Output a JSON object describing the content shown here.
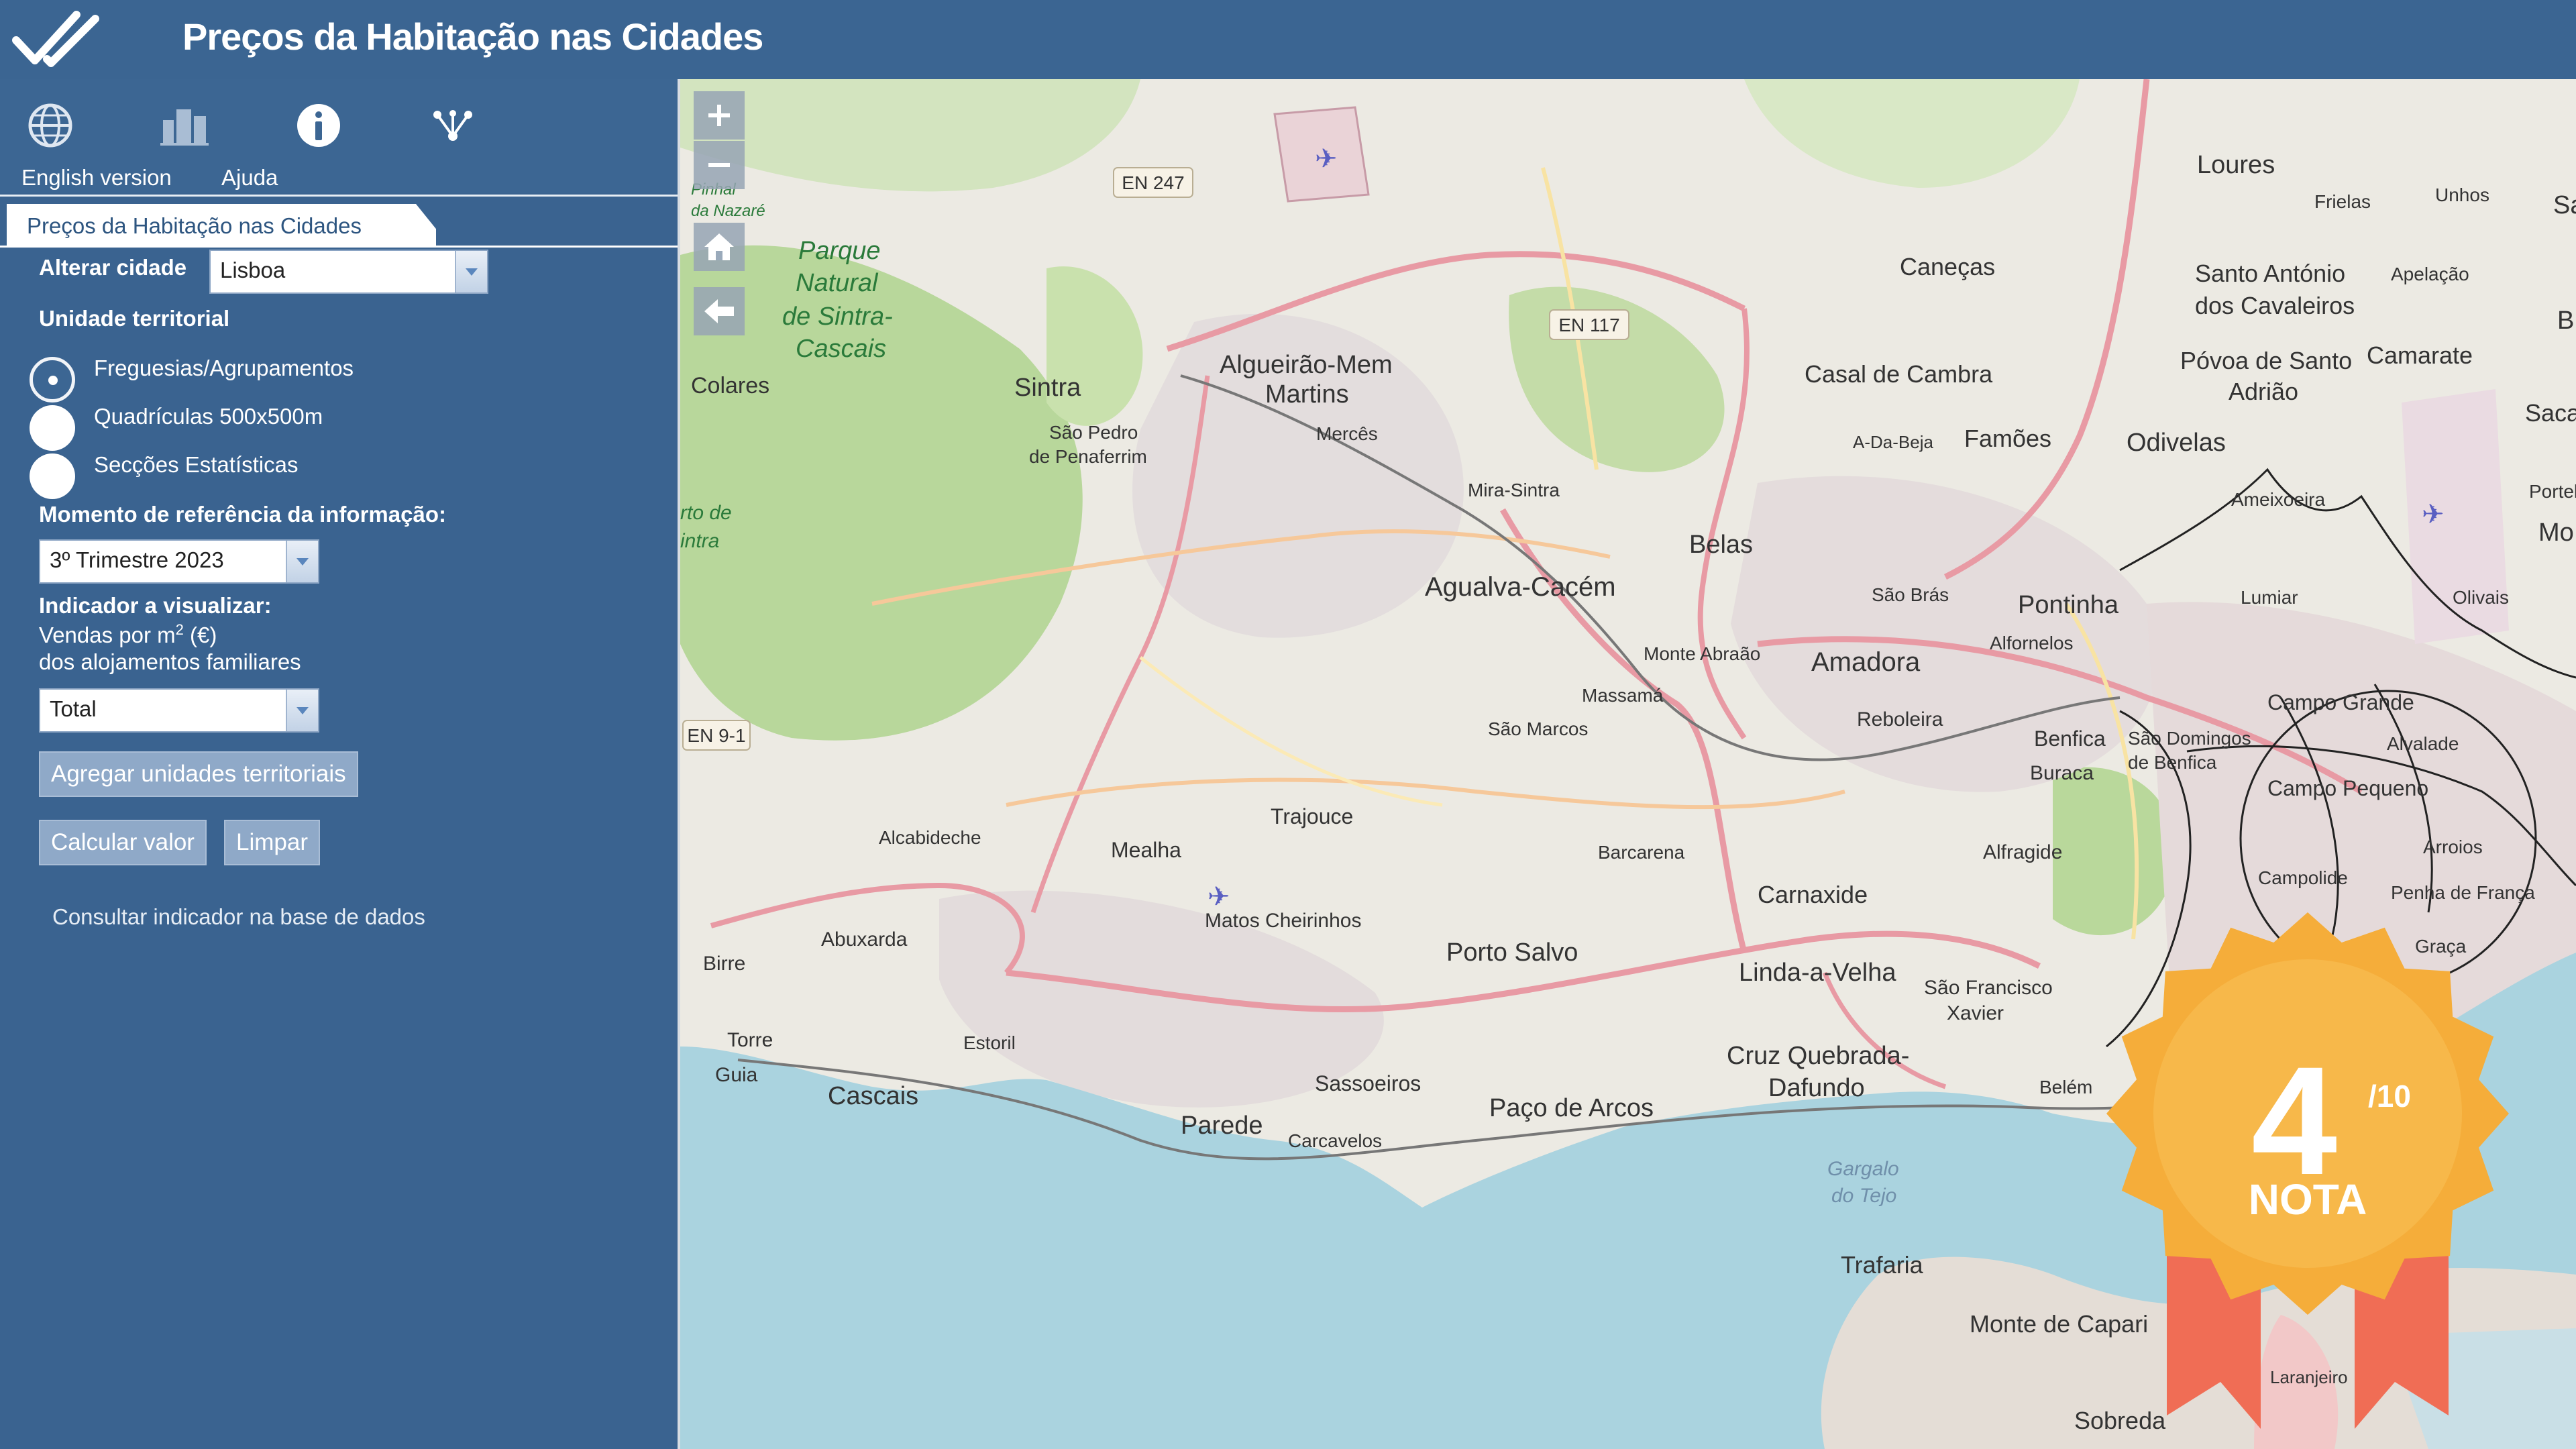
{
  "header": {
    "title": "Preços da Habitação nas Cidades"
  },
  "toolbar": {
    "tools": [
      {
        "icon": "globe-icon",
        "label": "English version"
      },
      {
        "icon": "buildings-icon",
        "label": "Ajuda"
      },
      {
        "icon": "info-icon"
      },
      {
        "icon": "share-network-icon"
      }
    ]
  },
  "panel": {
    "tab_title": "Preços da Habitação nas Cidades",
    "city_label": "Alterar cidade",
    "city_value": "Lisboa",
    "territorial_label": "Unidade territorial",
    "territorial_options": [
      "Freguesias/Agrupamentos",
      "Quadrículas 500x500m",
      "Secções Estatísticas"
    ],
    "territorial_selected": 0,
    "reference_label": "Momento de referência da informação:",
    "reference_value": "3º Trimestre 2023",
    "indicator_label": "Indicador a visualizar:",
    "indicator_line1": "Vendas por m",
    "indicator_sup": "2",
    "indicator_unit": " (€)",
    "indicator_line2": "dos alojamentos familiares",
    "indicator_value": "Total",
    "aggregate_button": "Agregar unidades territoriais",
    "calculate_button": "Calcular valor",
    "clear_button": "Limpar",
    "database_link": "Consultar indicador na base de dados"
  },
  "map": {
    "controls": [
      "zoom-in-icon",
      "zoom-out-icon",
      "home-icon",
      "back-arrow-icon"
    ],
    "place_labels": {
      "loures": "Loures",
      "frielas": "Frielas",
      "unhos": "Unhos",
      "santo_antonio": "Santo António",
      "dos_cavaleiros": "dos Cavaleiros",
      "apelacao": "Apelação",
      "povoa1": "Póvoa de Santo",
      "povoa2": "Adrião",
      "camarate": "Camarate",
      "sacavem": "Saca",
      "canecas": "Caneças",
      "casal_cambra": "Casal de Cambra",
      "famoes": "Famões",
      "odivelas": "Odivelas",
      "a_da_beja": "A-Da-Beja",
      "algueirao1": "Algueirão-Mem",
      "algueirao2": "Martins",
      "merces": "Mercês",
      "sintra": "Sintra",
      "sao_pedro1": "São Pedro",
      "sao_pedro2": "de Penaferrim",
      "colares": "Colares",
      "parque1": "Parque",
      "parque2": "Natural",
      "parque3": "de Sintra-",
      "parque4": "Cascais",
      "mira_sintra": "Mira-Sintra",
      "belas": "Belas",
      "agualva": "Agualva-Cacém",
      "sao_bras": "São Brás",
      "pontinha": "Pontinha",
      "alfornelos": "Alfornelos",
      "ameixoeira": "Ameixoeira",
      "lumiar": "Lumiar",
      "olivais": "Olivais",
      "monte_abraao": "Monte Abraão",
      "amadora": "Amadora",
      "massama": "Massamá",
      "reboleira": "Reboleira",
      "sao_marcos": "São Marcos",
      "benfica": "Benfica",
      "sao_domingos1": "São Domingos",
      "sao_domingos2": "de Benfica",
      "campo_grande": "Campo Grande",
      "alvalade": "Alvalade",
      "campo_pequeno": "Campo Pequeno",
      "buraca": "Buraca",
      "alfragide": "Alfragide",
      "arroios": "Arroios",
      "campolide": "Campolide",
      "penha": "Penha de França",
      "graca": "Graça",
      "trajouce": "Trajouce",
      "alcabideche": "Alcabideche",
      "mealha": "Mealha",
      "barcarena": "Barcarena",
      "carnaxide": "Carnaxide",
      "matos": "Matos Cheirinhos",
      "abuxarda": "Abuxarda",
      "birre": "Birre",
      "porto_salvo": "Porto Salvo",
      "linda": "Linda-a-Velha",
      "sao_francisco1": "São Francisco",
      "sao_francisco2": "Xavier",
      "estoril": "Estoril",
      "torre": "Torre",
      "guia": "Guia",
      "cascais": "Cascais",
      "cruz1": "Cruz Quebrada-",
      "cruz2": "Dafundo",
      "belem": "Belém",
      "sassoeiros": "Sassoeiros",
      "parede": "Parede",
      "carcavelos": "Carcavelos",
      "paco": "Paço de Arcos",
      "gargalo1": "Gargalo",
      "gargalo2": "do Tejo",
      "trafaria": "Trafaria",
      "monte_caparica": "Monte de Capari",
      "laranjeiro": "Laranjeiro",
      "sobreda": "Sobreda",
      "pinhal": "Pinhal",
      "da_nazare": "da Nazaré",
      "rto_de": "rto de",
      "intra": "intra",
      "mo": "Mo",
      "portel": "Portel",
      "sa": "Sa",
      "b": "B"
    },
    "road_shields": [
      "EN 247",
      "EN 117",
      "EN 9-1"
    ]
  },
  "badge": {
    "score": "4",
    "out_of": "/10",
    "label": "NOTA"
  },
  "colors": {
    "header": "#3b6592",
    "sidebar": "#3a6390",
    "badge_gold": "#f7b84a",
    "ribbon": "#f06d55"
  }
}
